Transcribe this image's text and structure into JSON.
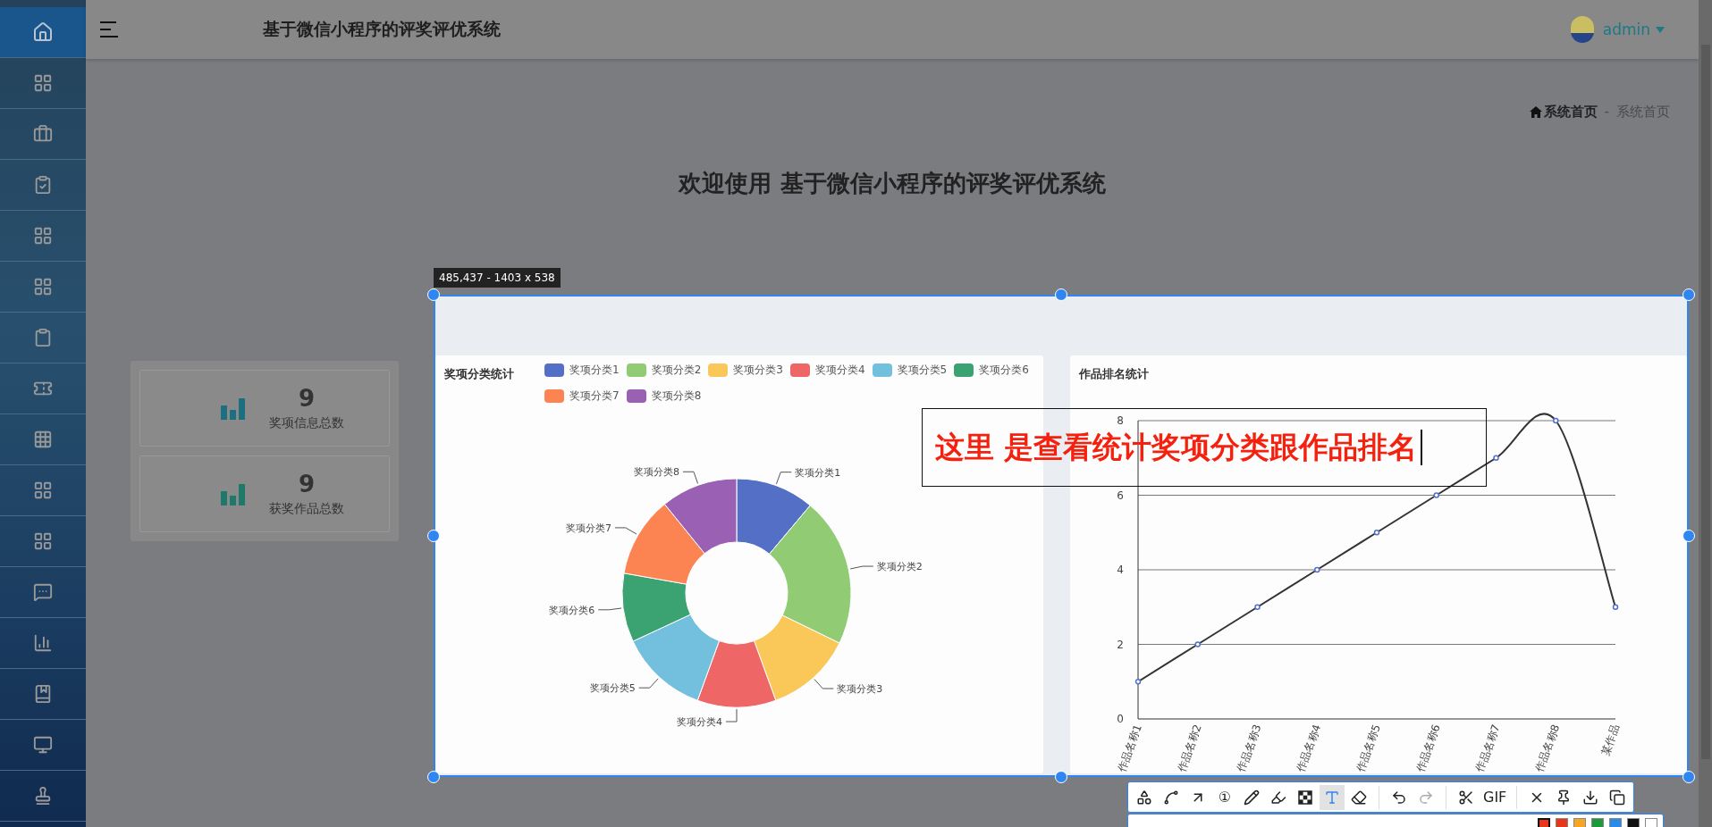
{
  "sidebar": {
    "items": [
      {
        "kind": "home",
        "selected": true
      },
      {
        "kind": "grid",
        "selected": false
      },
      {
        "kind": "briefcase",
        "selected": false
      },
      {
        "kind": "clipboard-check",
        "selected": false
      },
      {
        "kind": "grid",
        "selected": false
      },
      {
        "kind": "grid",
        "selected": false
      },
      {
        "kind": "clipboard",
        "selected": false
      },
      {
        "kind": "ticket",
        "selected": false
      },
      {
        "kind": "grid-3x3",
        "selected": false
      },
      {
        "kind": "grid",
        "selected": false
      },
      {
        "kind": "grid",
        "selected": false
      },
      {
        "kind": "message",
        "selected": false
      },
      {
        "kind": "bar-chart",
        "selected": false
      },
      {
        "kind": "book",
        "selected": false
      },
      {
        "kind": "monitor",
        "selected": false
      },
      {
        "kind": "stamp",
        "selected": false
      }
    ]
  },
  "header": {
    "title": "基于微信小程序的评奖评优系统",
    "user": "admin"
  },
  "breadcrumb": {
    "home": "系统首页",
    "separator": "-",
    "current": "系统首页"
  },
  "welcome": "欢迎使用 基于微信小程序的评奖评优系统",
  "stats": [
    {
      "value": "9",
      "label": "奖项信息总数"
    },
    {
      "value": "9",
      "label": "获奖作品总数"
    }
  ],
  "category_chart": {
    "title": "奖项分类统计",
    "legend": [
      {
        "label": "奖项分类1",
        "color": "#5470c6"
      },
      {
        "label": "奖项分类2",
        "color": "#91cc75"
      },
      {
        "label": "奖项分类3",
        "color": "#fac858"
      },
      {
        "label": "奖项分类4",
        "color": "#ee6666"
      },
      {
        "label": "奖项分类5",
        "color": "#73c0de"
      },
      {
        "label": "奖项分类6",
        "color": "#3ba272"
      },
      {
        "label": "奖项分类7",
        "color": "#fc8452"
      },
      {
        "label": "奖项分类8",
        "color": "#9a60b4"
      }
    ],
    "slices": [
      {
        "label": "奖项分类1",
        "color": "#5470c6"
      },
      {
        "label": "奖项分类2",
        "color": "#91cc75"
      },
      {
        "label": "奖项分类3",
        "color": "#fac858"
      },
      {
        "label": "奖项分类4",
        "color": "#ee6666"
      },
      {
        "label": "奖项分类5",
        "color": "#73c0de"
      },
      {
        "label": "奖项分类6",
        "color": "#3ba272"
      },
      {
        "label": "奖项分类7",
        "color": "#fc8452"
      },
      {
        "label": "奖项分类8",
        "color": "#9a60b4"
      }
    ]
  },
  "ranking_chart": {
    "title": "作品排名统计",
    "chart_data": {
      "type": "line",
      "categories": [
        "作品名称1",
        "作品名称2",
        "作品名称3",
        "作品名称4",
        "作品名称5",
        "作品名称6",
        "作品名称7",
        "作品名称8",
        "某作品"
      ],
      "series": [
        {
          "color": "#333333",
          "marker": "circle",
          "values": [
            1,
            2,
            3,
            4,
            5,
            6,
            7,
            8,
            3
          ]
        }
      ],
      "grid": true,
      "ylim": [
        0,
        8
      ],
      "yticks": [
        0,
        2,
        4,
        6,
        8
      ]
    }
  },
  "capture": {
    "dimensions": "485,437 - 1403 x 538",
    "annotation": "这里 是查看统计奖项分类跟作品排名",
    "tools": [
      {
        "kind": "shapes",
        "selected": false,
        "disabled": false
      },
      {
        "kind": "polyline",
        "selected": false,
        "disabled": false
      },
      {
        "kind": "arrow",
        "selected": false,
        "disabled": false
      },
      {
        "kind": "number",
        "label": "①",
        "selected": false,
        "disabled": false
      },
      {
        "kind": "pen",
        "selected": false,
        "disabled": false
      },
      {
        "kind": "marker",
        "selected": false,
        "disabled": false
      },
      {
        "kind": "mosaic",
        "selected": false,
        "disabled": false
      },
      {
        "kind": "text",
        "selected": true,
        "disabled": false
      },
      {
        "kind": "eraser",
        "selected": false,
        "disabled": false
      },
      {
        "kind": "undo",
        "selected": false,
        "disabled": false
      },
      {
        "kind": "redo",
        "selected": false,
        "disabled": true
      },
      {
        "kind": "scissors",
        "selected": false,
        "disabled": false
      },
      {
        "kind": "gif",
        "label": "GIF",
        "selected": false,
        "disabled": false
      },
      {
        "kind": "close",
        "selected": false,
        "disabled": false
      },
      {
        "kind": "pin",
        "selected": false,
        "disabled": false
      },
      {
        "kind": "download",
        "selected": false,
        "disabled": false
      },
      {
        "kind": "copy",
        "selected": false,
        "disabled": false
      }
    ],
    "swatches": [
      {
        "color": "#e8361c",
        "selected": true
      },
      {
        "color": "#e8361c",
        "selected": false
      },
      {
        "color": "#f5a623",
        "selected": false
      },
      {
        "color": "#1e9a3c",
        "selected": false
      },
      {
        "color": "#2b8ae8",
        "selected": false
      },
      {
        "color": "#111111",
        "selected": false
      },
      {
        "color": "#ffffff",
        "selected": false
      }
    ]
  }
}
